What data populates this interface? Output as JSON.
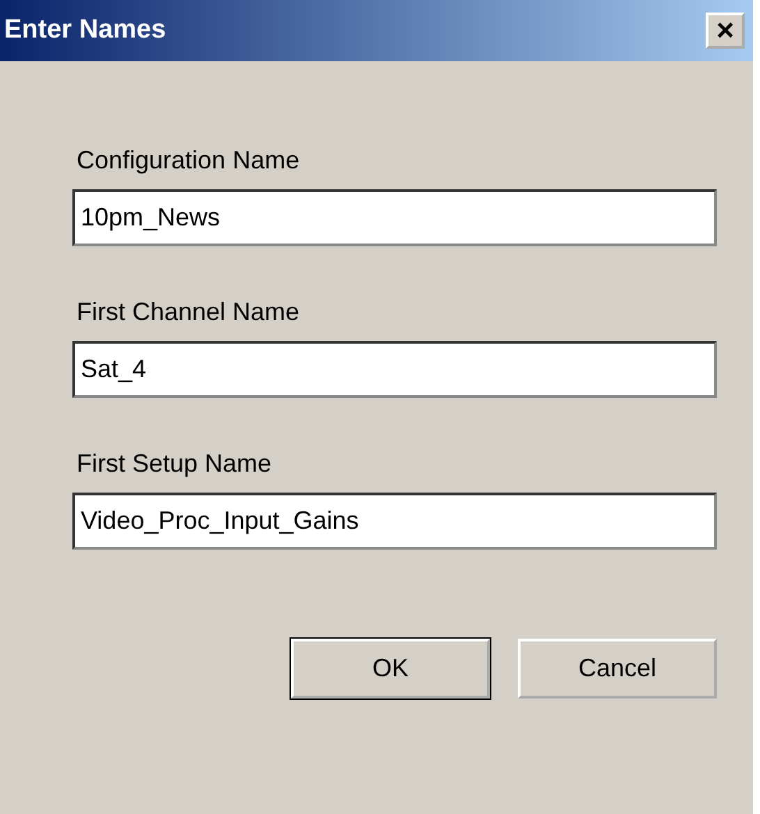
{
  "window": {
    "title": "Enter Names",
    "close": "×"
  },
  "fields": [
    {
      "label": "Configuration Name",
      "value": "10pm_News"
    },
    {
      "label": "First Channel Name",
      "value": "Sat_4"
    },
    {
      "label": "First Setup Name",
      "value": "Video_Proc_Input_Gains"
    }
  ],
  "buttons": [
    {
      "label": "OK",
      "default": true
    },
    {
      "label": "Cancel",
      "default": false
    }
  ]
}
